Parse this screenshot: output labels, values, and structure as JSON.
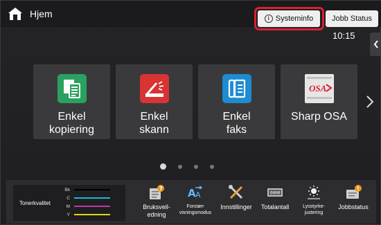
{
  "topbar": {
    "home_label": "Hjem",
    "sysinfo_label": "Systeminfo",
    "jobstatus_label": "Jobb Status",
    "highlight_color": "#d8212f"
  },
  "clock": "10:15",
  "tiles": [
    {
      "label": "Enkel\nkopiering",
      "icon": "copy-icon",
      "color": "#2aa160"
    },
    {
      "label": "Enkel\nskann",
      "icon": "scan-icon",
      "color": "#d93333"
    },
    {
      "label": "Enkel\nfaks",
      "icon": "fax-icon",
      "color": "#1e8bd2"
    },
    {
      "label": "Sharp OSA",
      "icon": "sharp-osa-icon",
      "color": "#e8e8e8"
    }
  ],
  "pagination": {
    "pages": 4,
    "current": 1
  },
  "toner": {
    "label": "Tonerkvalitet",
    "rows": [
      {
        "name": "Bk",
        "color": "#000000"
      },
      {
        "name": "C",
        "color": "#19b9e0"
      },
      {
        "name": "M",
        "color": "#c03aa0"
      },
      {
        "name": "Y",
        "color": "#e6d21e"
      }
    ]
  },
  "bottom_items": [
    {
      "label": "Bruksveil-\nedning",
      "icon": "manual-icon",
      "small": false
    },
    {
      "label": "Forstørr\nvisningsmodus",
      "icon": "enlarge-text-icon",
      "small": true
    },
    {
      "label": "Innstillinger",
      "icon": "settings-tools-icon",
      "small": false
    },
    {
      "label": "Totalantall",
      "icon": "counter-icon",
      "small": false
    },
    {
      "label": "Lysstyrke-\njustering",
      "icon": "brightness-icon",
      "small": true
    },
    {
      "label": "Jobbstatus",
      "icon": "job-status-icon",
      "small": false
    }
  ]
}
